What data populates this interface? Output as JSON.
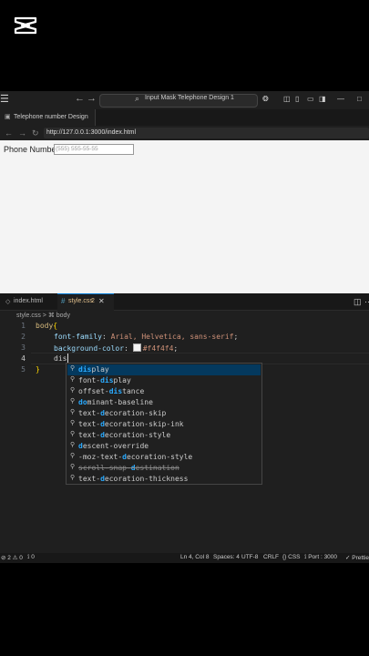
{
  "titlebar": {
    "search_text": "Input Mask Telephone Design 1"
  },
  "browser": {
    "tab_label": "Telephone number Design",
    "url": "http://127.0.0.1:3000/index.html"
  },
  "preview": {
    "phone_label": "Phone Number",
    "phone_placeholder": "(555) 555-55-55"
  },
  "editor": {
    "tabs": [
      {
        "label": "index.html"
      },
      {
        "label": "style.css",
        "count": "2",
        "close": "✕"
      }
    ],
    "breadcrumb": "style.css > ⌘ body",
    "line_numbers": [
      "1",
      "2",
      "3",
      "4",
      "5"
    ],
    "code": {
      "l1_selector": "body",
      "l1_brace": "{",
      "l2_prop": "font-family",
      "l2_val": "Arial, Helvetica, sans-serif",
      "l3_prop": "background-color",
      "l3_val": "#f4f4f4",
      "l4_text": "dis",
      "l5_brace": "}"
    }
  },
  "suggestions": [
    {
      "pre": "",
      "hl": "dis",
      "post": "play"
    },
    {
      "pre": "font-",
      "hl": "dis",
      "post": "play"
    },
    {
      "pre": "offset-",
      "hl": "dis",
      "post": "tance"
    },
    {
      "pre": "",
      "hl": "do",
      "post": "minant-baseline"
    },
    {
      "pre": "text-",
      "hl": "d",
      "post": "ecoration-skip"
    },
    {
      "pre": "text-",
      "hl": "d",
      "post": "ecoration-skip-ink"
    },
    {
      "pre": "text-",
      "hl": "d",
      "post": "ecoration-style"
    },
    {
      "pre": "",
      "hl": "d",
      "post": "escent-override"
    },
    {
      "pre": "-moz-text-",
      "hl": "d",
      "post": "ecoration-style"
    },
    {
      "pre": "scroll-snap-",
      "hl": "d",
      "post": "estination"
    },
    {
      "pre": "text-",
      "hl": "d",
      "post": "ecoration-thickness"
    }
  ],
  "status": {
    "problems": "⊘ 2 ⚠ 0",
    "ports": "⟟ 0",
    "position": "Ln 4, Col 8",
    "spaces": "Spaces: 4",
    "encoding": "UTF-8",
    "eol": "CRLF",
    "language": "{} CSS",
    "port": "⟟ Port : 3000",
    "prettier": "✓ Prettier"
  },
  "colors": {
    "accent": "#0078d4",
    "preview_bg": "#f4f4f4",
    "selected_suggestion": "#04395e"
  }
}
